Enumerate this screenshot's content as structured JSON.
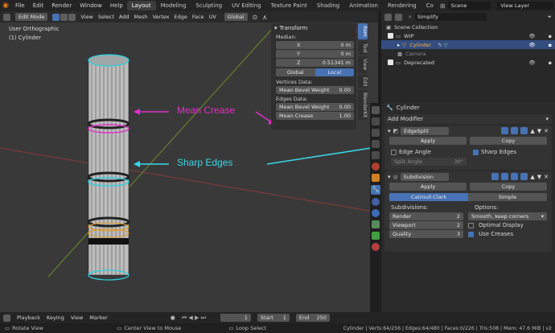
{
  "topbar": {
    "menus": [
      "File",
      "Edit",
      "Render",
      "Window",
      "Help"
    ],
    "workspaces": [
      "Layout",
      "Modeling",
      "Sculpting",
      "UV Editing",
      "Texture Paint",
      "Shading",
      "Animation",
      "Rendering",
      "Co"
    ],
    "active_workspace": "Layout",
    "scene_label": "Scene",
    "view_layer_label": "View Layer"
  },
  "viewport": {
    "mode": "Edit Mode",
    "menus": [
      "View",
      "Select",
      "Add",
      "Mesh",
      "Vertex",
      "Edge",
      "Face",
      "UV"
    ],
    "transform_orientation": "Global",
    "view_name": "User Orthographic",
    "object_name": "(1) Cylinder",
    "annotation_crease": "Mean Crease",
    "annotation_sharp": "Sharp Edges",
    "annotation_color_crease": "#e030c8",
    "annotation_color_sharp": "#38d8e8"
  },
  "npanel": {
    "header": "Transform",
    "median_label": "Median:",
    "fields": [
      {
        "label": "X",
        "value": "0 m"
      },
      {
        "label": "Y",
        "value": "0 m"
      },
      {
        "label": "Z",
        "value": "0.51341 m"
      }
    ],
    "global_label": "Global",
    "local_label": "Local",
    "vertices_data_label": "Vertices Data:",
    "vert_bevel_label": "Mean Bevel Weight",
    "vert_bevel_value": "0.00",
    "edges_data_label": "Edges Data:",
    "edge_bevel_label": "Mean Bevel Weight",
    "edge_bevel_value": "0.00",
    "crease_label": "Mean Crease",
    "crease_value": "1.00",
    "tabs": [
      "Item",
      "Tool",
      "View",
      "Edit",
      "BlenderKit"
    ]
  },
  "outliner": {
    "search_label": "Simplify",
    "rows": [
      {
        "label": "Scene Collection",
        "checked": null
      },
      {
        "label": "WIP",
        "checked": true
      },
      {
        "label": "Cylinder",
        "checked": null
      },
      {
        "label": "Camera",
        "checked": null
      },
      {
        "label": "Deprecated",
        "checked": true
      }
    ]
  },
  "properties": {
    "object_name": "Cylinder",
    "add_modifier_label": "Add Modifier",
    "edgesplit": {
      "name": "EdgeSplit",
      "apply_label": "Apply",
      "copy_label": "Copy",
      "edge_angle_label": "Edge Angle",
      "edge_angle_checked": false,
      "sharp_edges_label": "Sharp Edges",
      "sharp_edges_checked": true,
      "split_angle_label": "Split Angle",
      "split_angle_value": "30°"
    },
    "subdivision": {
      "name": "Subdivision",
      "apply_label": "Apply",
      "copy_label": "Copy",
      "catmull_label": "Catmull-Clark",
      "simple_label": "Simple",
      "subdivisions_label": "Subdivisions:",
      "options_label": "Options:",
      "render_label": "Render",
      "render_value": "2",
      "viewport_label": "Viewport",
      "viewport_value": "2",
      "quality_label": "Quality",
      "quality_value": "3",
      "smooth_label": "Smooth, keep corners",
      "optimal_label": "Optimal Display",
      "optimal_checked": false,
      "creases_label": "Use Creases",
      "creases_checked": true
    }
  },
  "timeline": {
    "menus": [
      "Playback",
      "Keying",
      "View",
      "Marker"
    ],
    "current_frame": "1",
    "start_label": "Start",
    "start_value": "1",
    "end_label": "End",
    "end_value": "250"
  },
  "status": {
    "left": "Rotate View",
    "middle": "Center View to Mouse",
    "right_hint": "Loop Select",
    "stats": "Cylinder | Verts:64/256 | Edges:64/480 | Faces:0/226 | Tris:508 | Mem: 47.6 MiB | v2"
  }
}
